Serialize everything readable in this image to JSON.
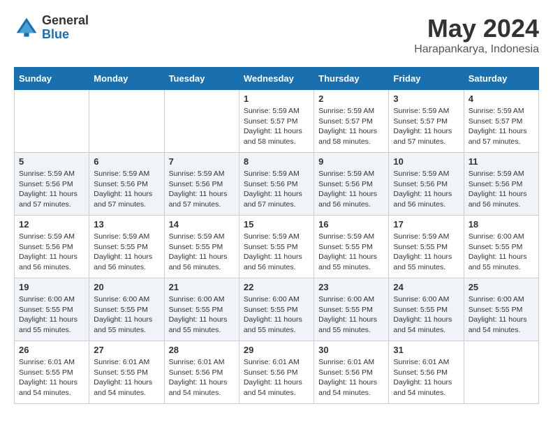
{
  "logo": {
    "line1": "General",
    "line2": "Blue"
  },
  "title": "May 2024",
  "subtitle": "Harapankarya, Indonesia",
  "days_header": [
    "Sunday",
    "Monday",
    "Tuesday",
    "Wednesday",
    "Thursday",
    "Friday",
    "Saturday"
  ],
  "weeks": [
    [
      {
        "day": "",
        "info": ""
      },
      {
        "day": "",
        "info": ""
      },
      {
        "day": "",
        "info": ""
      },
      {
        "day": "1",
        "info": "Sunrise: 5:59 AM\nSunset: 5:57 PM\nDaylight: 11 hours\nand 58 minutes."
      },
      {
        "day": "2",
        "info": "Sunrise: 5:59 AM\nSunset: 5:57 PM\nDaylight: 11 hours\nand 58 minutes."
      },
      {
        "day": "3",
        "info": "Sunrise: 5:59 AM\nSunset: 5:57 PM\nDaylight: 11 hours\nand 57 minutes."
      },
      {
        "day": "4",
        "info": "Sunrise: 5:59 AM\nSunset: 5:57 PM\nDaylight: 11 hours\nand 57 minutes."
      }
    ],
    [
      {
        "day": "5",
        "info": "Sunrise: 5:59 AM\nSunset: 5:56 PM\nDaylight: 11 hours\nand 57 minutes."
      },
      {
        "day": "6",
        "info": "Sunrise: 5:59 AM\nSunset: 5:56 PM\nDaylight: 11 hours\nand 57 minutes."
      },
      {
        "day": "7",
        "info": "Sunrise: 5:59 AM\nSunset: 5:56 PM\nDaylight: 11 hours\nand 57 minutes."
      },
      {
        "day": "8",
        "info": "Sunrise: 5:59 AM\nSunset: 5:56 PM\nDaylight: 11 hours\nand 57 minutes."
      },
      {
        "day": "9",
        "info": "Sunrise: 5:59 AM\nSunset: 5:56 PM\nDaylight: 11 hours\nand 56 minutes."
      },
      {
        "day": "10",
        "info": "Sunrise: 5:59 AM\nSunset: 5:56 PM\nDaylight: 11 hours\nand 56 minutes."
      },
      {
        "day": "11",
        "info": "Sunrise: 5:59 AM\nSunset: 5:56 PM\nDaylight: 11 hours\nand 56 minutes."
      }
    ],
    [
      {
        "day": "12",
        "info": "Sunrise: 5:59 AM\nSunset: 5:56 PM\nDaylight: 11 hours\nand 56 minutes."
      },
      {
        "day": "13",
        "info": "Sunrise: 5:59 AM\nSunset: 5:55 PM\nDaylight: 11 hours\nand 56 minutes."
      },
      {
        "day": "14",
        "info": "Sunrise: 5:59 AM\nSunset: 5:55 PM\nDaylight: 11 hours\nand 56 minutes."
      },
      {
        "day": "15",
        "info": "Sunrise: 5:59 AM\nSunset: 5:55 PM\nDaylight: 11 hours\nand 56 minutes."
      },
      {
        "day": "16",
        "info": "Sunrise: 5:59 AM\nSunset: 5:55 PM\nDaylight: 11 hours\nand 55 minutes."
      },
      {
        "day": "17",
        "info": "Sunrise: 5:59 AM\nSunset: 5:55 PM\nDaylight: 11 hours\nand 55 minutes."
      },
      {
        "day": "18",
        "info": "Sunrise: 6:00 AM\nSunset: 5:55 PM\nDaylight: 11 hours\nand 55 minutes."
      }
    ],
    [
      {
        "day": "19",
        "info": "Sunrise: 6:00 AM\nSunset: 5:55 PM\nDaylight: 11 hours\nand 55 minutes."
      },
      {
        "day": "20",
        "info": "Sunrise: 6:00 AM\nSunset: 5:55 PM\nDaylight: 11 hours\nand 55 minutes."
      },
      {
        "day": "21",
        "info": "Sunrise: 6:00 AM\nSunset: 5:55 PM\nDaylight: 11 hours\nand 55 minutes."
      },
      {
        "day": "22",
        "info": "Sunrise: 6:00 AM\nSunset: 5:55 PM\nDaylight: 11 hours\nand 55 minutes."
      },
      {
        "day": "23",
        "info": "Sunrise: 6:00 AM\nSunset: 5:55 PM\nDaylight: 11 hours\nand 55 minutes."
      },
      {
        "day": "24",
        "info": "Sunrise: 6:00 AM\nSunset: 5:55 PM\nDaylight: 11 hours\nand 54 minutes."
      },
      {
        "day": "25",
        "info": "Sunrise: 6:00 AM\nSunset: 5:55 PM\nDaylight: 11 hours\nand 54 minutes."
      }
    ],
    [
      {
        "day": "26",
        "info": "Sunrise: 6:01 AM\nSunset: 5:55 PM\nDaylight: 11 hours\nand 54 minutes."
      },
      {
        "day": "27",
        "info": "Sunrise: 6:01 AM\nSunset: 5:55 PM\nDaylight: 11 hours\nand 54 minutes."
      },
      {
        "day": "28",
        "info": "Sunrise: 6:01 AM\nSunset: 5:56 PM\nDaylight: 11 hours\nand 54 minutes."
      },
      {
        "day": "29",
        "info": "Sunrise: 6:01 AM\nSunset: 5:56 PM\nDaylight: 11 hours\nand 54 minutes."
      },
      {
        "day": "30",
        "info": "Sunrise: 6:01 AM\nSunset: 5:56 PM\nDaylight: 11 hours\nand 54 minutes."
      },
      {
        "day": "31",
        "info": "Sunrise: 6:01 AM\nSunset: 5:56 PM\nDaylight: 11 hours\nand 54 minutes."
      },
      {
        "day": "",
        "info": ""
      }
    ]
  ]
}
